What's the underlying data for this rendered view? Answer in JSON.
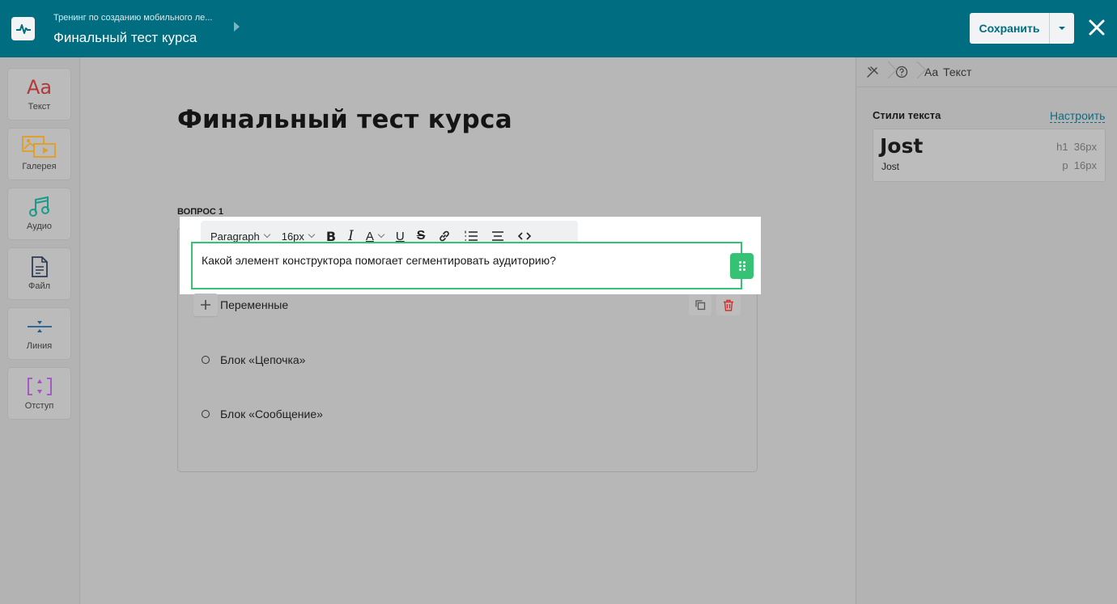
{
  "header": {
    "course_title": "Тренинг по созданию мобильного ле...",
    "page_title": "Финальный тест курса",
    "save_label": "Сохранить"
  },
  "toolbox": {
    "items": [
      {
        "label": "Текст",
        "icon": "text-aa-icon",
        "glyph": "Aa"
      },
      {
        "label": "Галерея",
        "icon": "gallery-icon"
      },
      {
        "label": "Аудио",
        "icon": "audio-icon"
      },
      {
        "label": "Файл",
        "icon": "file-icon"
      },
      {
        "label": "Линия",
        "icon": "line-icon"
      },
      {
        "label": "Отступ",
        "icon": "spacing-icon"
      }
    ]
  },
  "canvas": {
    "title": "Финальный тест курса",
    "question_label": "ВОПРОС 1",
    "question_text": "Какой элемент конструктора помогает сегментировать аудиторию?",
    "variables_label": "Переменные",
    "options": [
      "Блок «Цепочка»",
      "Блок «Сообщение»"
    ]
  },
  "format_toolbar": {
    "paragraph": "Paragraph",
    "font_size": "16px"
  },
  "right_panel": {
    "breadcrumb_current": "Текст",
    "breadcrumb_glyph": "Aa",
    "styles_heading": "Стили текста",
    "configure_link": "Настроить",
    "style_card": {
      "h1_font": "Jost",
      "p_font": "Jost",
      "h1_meta": "h1  36px",
      "p_meta": "p  16px"
    }
  },
  "colors": {
    "brand": "#016d81",
    "accent_green": "#35c275",
    "delete_red": "#d0312d",
    "gallery": "#e39d1f",
    "audio": "#1b9a8a",
    "line": "#1d5f8a",
    "spacing": "#a64dc8"
  }
}
